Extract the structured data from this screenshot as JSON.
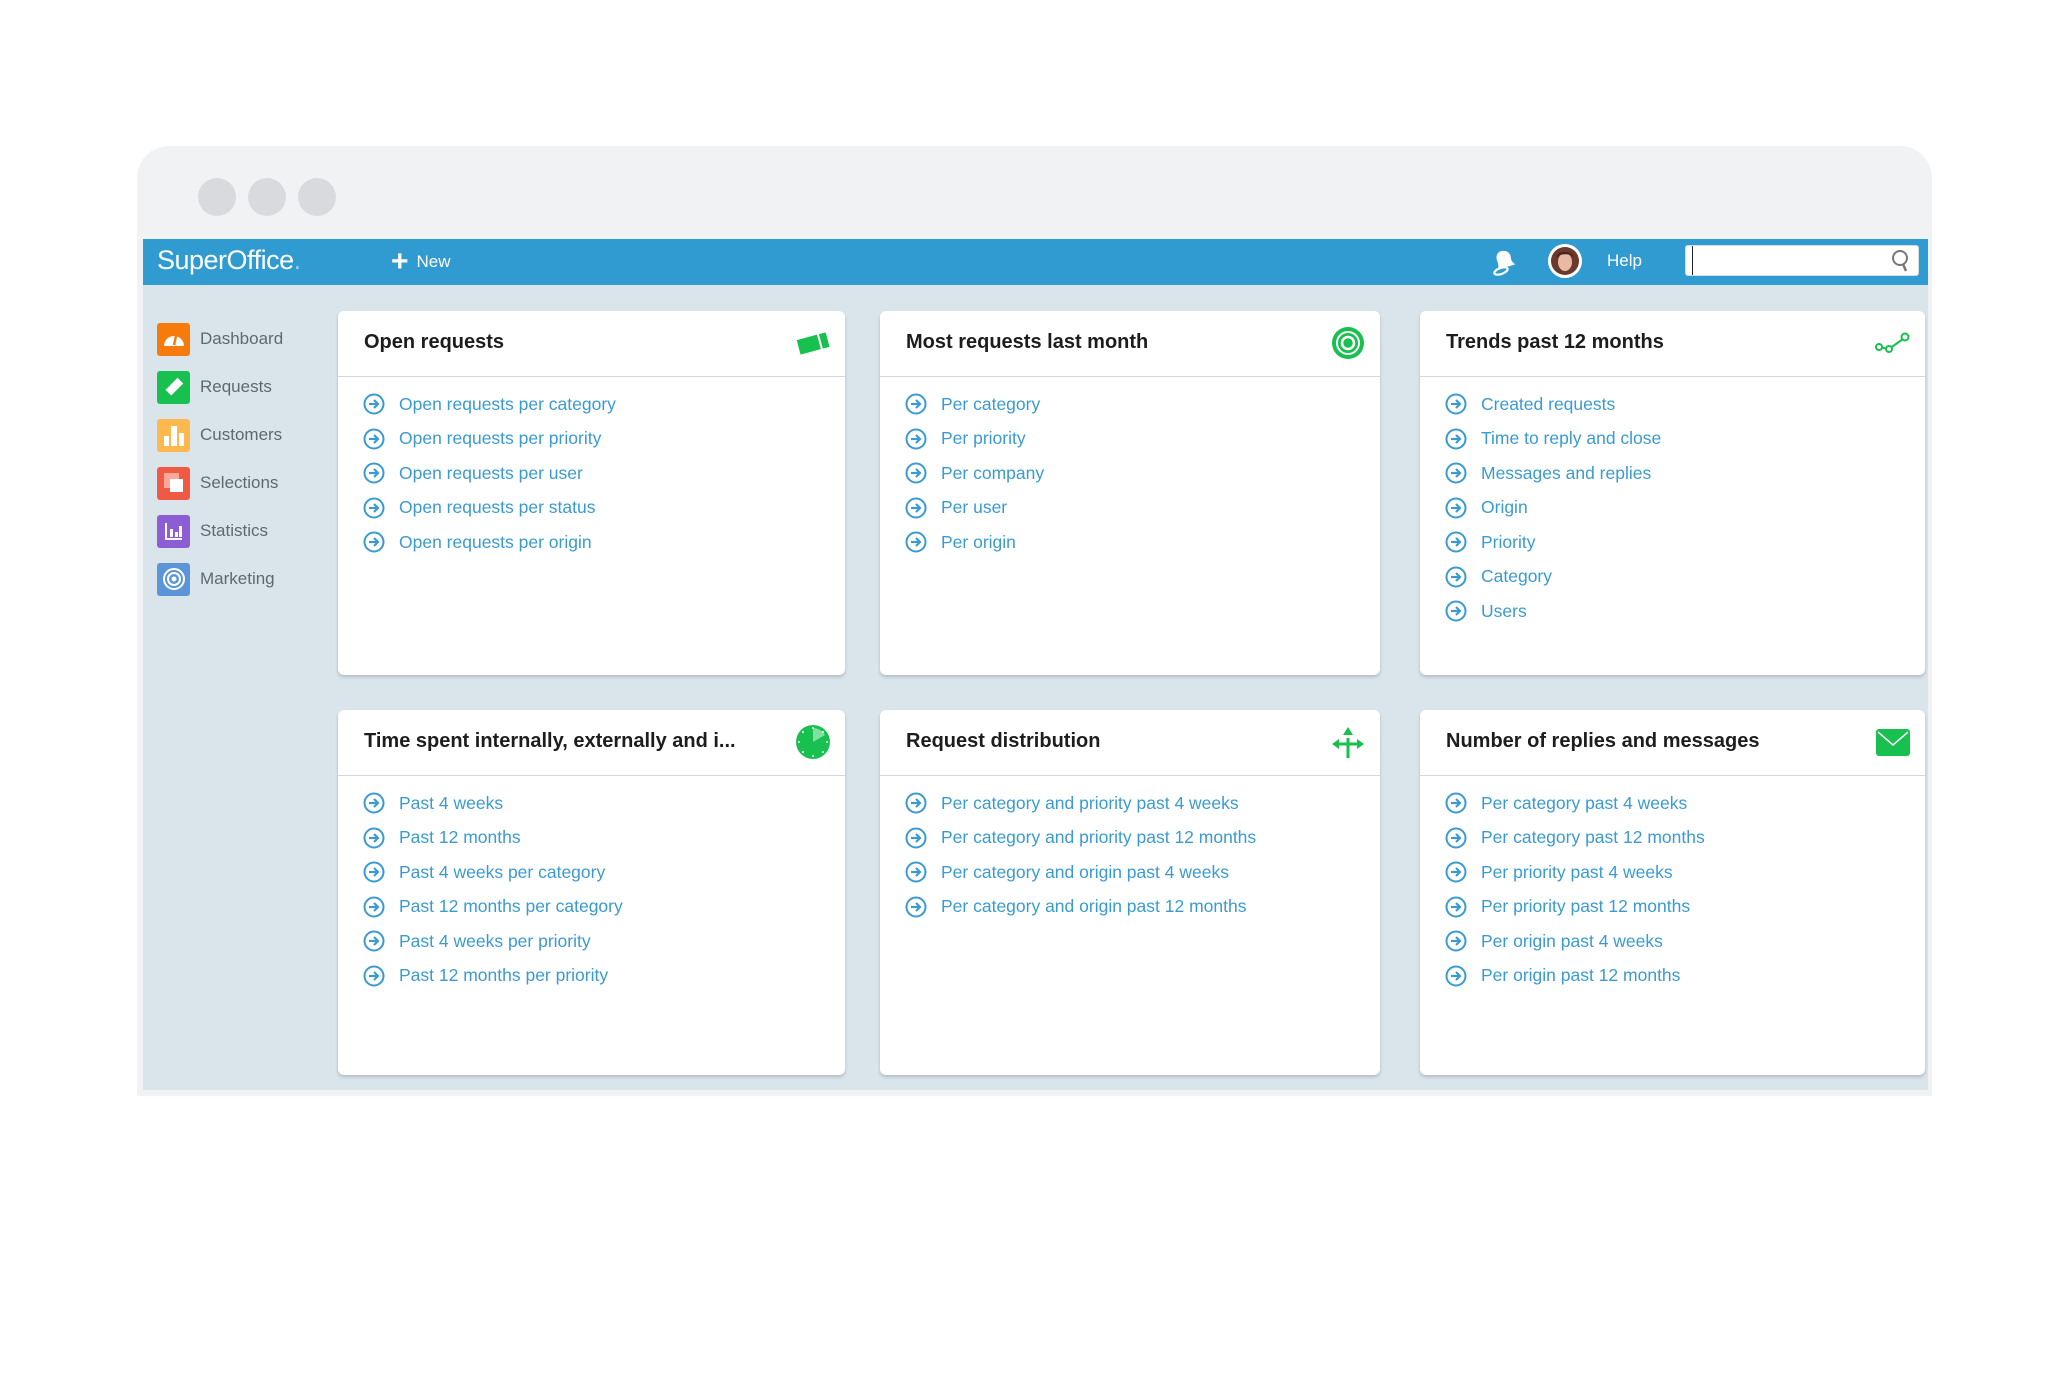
{
  "window": {
    "controls": [
      "dot-1",
      "dot-2",
      "dot-3"
    ]
  },
  "topbar": {
    "logo_text": "SuperOffice",
    "logo_dot": ".",
    "new_label": "New",
    "notifications_icon": "bell-icon",
    "avatar": "user-avatar",
    "help_label": "Help",
    "search_value": "",
    "search_placeholder": "",
    "search_icon": "search-icon"
  },
  "colors": {
    "brand_blue": "#2f9bd1",
    "link_blue": "#3a9bd2",
    "accent_green": "#18c04f",
    "content_bg": "#d9e4eb"
  },
  "sidebar": {
    "items": [
      {
        "label": "Dashboard",
        "icon": "dashboard-gauge-icon",
        "color": "#f77a0c"
      },
      {
        "label": "Requests",
        "icon": "ticket-icon",
        "color": "#18c04f"
      },
      {
        "label": "Customers",
        "icon": "buildings-icon",
        "color": "#fdb84e"
      },
      {
        "label": "Selections",
        "icon": "selections-squares-icon",
        "color": "#f05a44"
      },
      {
        "label": "Statistics",
        "icon": "bar-chart-icon",
        "color": "#8c5dd4"
      },
      {
        "label": "Marketing",
        "icon": "target-icon",
        "color": "#5b95d8"
      }
    ]
  },
  "cards": [
    {
      "title": "Open requests",
      "icon": "ticket-icon",
      "links": [
        "Open requests per category",
        "Open requests per priority",
        "Open requests per user",
        "Open requests per status",
        "Open requests per origin"
      ]
    },
    {
      "title": "Most requests last month",
      "icon": "target-icon",
      "links": [
        "Per category",
        "Per priority",
        "Per company",
        "Per user",
        "Per origin"
      ]
    },
    {
      "title": "Trends past 12 months",
      "icon": "trend-line-icon",
      "links": [
        "Created requests",
        "Time to reply and close",
        "Messages and replies",
        "Origin",
        "Priority",
        "Category",
        "Users"
      ]
    },
    {
      "title": "Time spent internally, externally and i...",
      "icon": "clock-icon",
      "links": [
        "Past 4 weeks",
        "Past 12 months",
        "Past 4 weeks per category",
        "Past 12 months per category",
        "Past 4 weeks per priority",
        "Past 12 months per priority"
      ]
    },
    {
      "title": "Request distribution",
      "icon": "split-arrows-icon",
      "links": [
        "Per category and priority past 4 weeks",
        "Per category and priority past 12 months",
        "Per category and origin past 4 weeks",
        "Per category and origin past 12 months"
      ]
    },
    {
      "title": "Number of replies and messages",
      "icon": "envelope-icon",
      "links": [
        "Per category past 4 weeks",
        "Per category past 12 months",
        "Per priority past 4 weeks",
        "Per priority past 12 months",
        "Per origin past 4 weeks",
        "Per origin past 12 months"
      ]
    }
  ]
}
